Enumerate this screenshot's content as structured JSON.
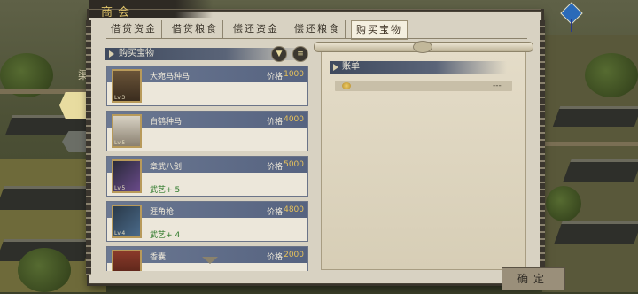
{
  "window": {
    "title": "商会"
  },
  "tabs": [
    {
      "label": "借贷资金",
      "active": false
    },
    {
      "label": "借贷粮食",
      "active": false
    },
    {
      "label": "偿还资金",
      "active": false
    },
    {
      "label": "偿还粮食",
      "active": false
    },
    {
      "label": "购买宝物",
      "active": true
    }
  ],
  "left_panel": {
    "section_label": "购买宝物",
    "filter_icon": "filter-icon",
    "list_icon": "list-icon",
    "price_label": "价格",
    "items": [
      {
        "name": "大宛马种马",
        "price": "1000",
        "level": "Lv.3",
        "stat_label": "",
        "stat_value": ""
      },
      {
        "name": "白鹤种马",
        "price": "4000",
        "level": "Lv.5",
        "stat_label": "",
        "stat_value": ""
      },
      {
        "name": "章武八剑",
        "price": "5000",
        "level": "Lv.5",
        "stat_label": "武艺+",
        "stat_value": "5"
      },
      {
        "name": "涯角枪",
        "price": "4800",
        "level": "Lv.4",
        "stat_label": "武艺+",
        "stat_value": "4"
      },
      {
        "name": "香囊",
        "price": "2000",
        "level": "",
        "stat_label": "",
        "stat_value": ""
      }
    ]
  },
  "right_panel": {
    "section_label": "账单",
    "row_value": "---"
  },
  "left_edge": {
    "fragment_label": "渠"
  },
  "confirm_button": {
    "label": "确定"
  },
  "colors": {
    "accent_gold": "#e0c46a",
    "price_gold": "#e8c25a",
    "stat_green": "#2e7a2a",
    "header_blue": "#566380"
  }
}
